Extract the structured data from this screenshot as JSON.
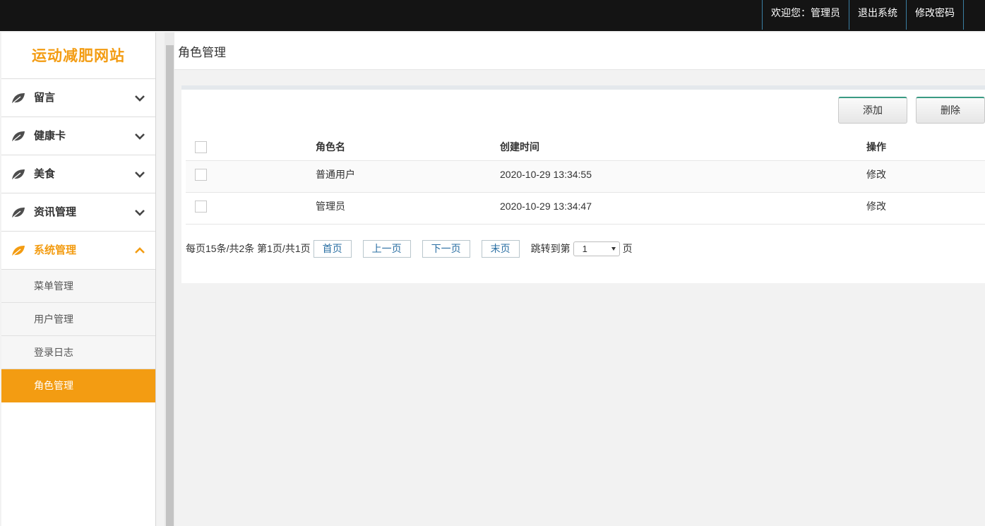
{
  "header": {
    "welcome": "欢迎您：管理员",
    "logout": "退出系统",
    "change_password": "修改密码"
  },
  "sidebar": {
    "brand": "运动减肥网站",
    "groups": [
      {
        "label": "留言",
        "icon": "leaf-icon",
        "expanded": false
      },
      {
        "label": "健康卡",
        "icon": "leaf-icon",
        "expanded": false
      },
      {
        "label": "美食",
        "icon": "leaf-icon",
        "expanded": false
      },
      {
        "label": "资讯管理",
        "icon": "leaf-icon",
        "expanded": false
      },
      {
        "label": "系统管理",
        "icon": "leaf-icon",
        "expanded": true
      }
    ],
    "sub_items": [
      "菜单管理",
      "用户管理",
      "登录日志",
      "角色管理"
    ],
    "active_sub_item": "角色管理"
  },
  "main": {
    "title": "角色管理",
    "buttons": {
      "add": "添加",
      "delete": "删除"
    },
    "table": {
      "headers": {
        "name": "角色名",
        "time": "创建时间",
        "op": "操作"
      },
      "rows": [
        {
          "name": "普通用户",
          "time": "2020-10-29 13:34:55",
          "op": "修改"
        },
        {
          "name": "管理员",
          "time": "2020-10-29 13:34:47",
          "op": "修改"
        }
      ]
    },
    "pager": {
      "summary": "每页15条/共2条 第1页/共1页",
      "first": "首页",
      "prev": "上一页",
      "next": "下一页",
      "last": "末页",
      "jump_label": "跳转到第",
      "selected_page": "1",
      "page_unit": "页"
    }
  },
  "colors": {
    "accent": "#f39c12",
    "topbar": "#141414",
    "link": "#2a6fa3"
  }
}
